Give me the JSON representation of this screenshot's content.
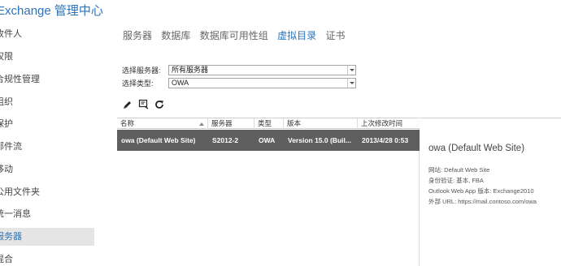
{
  "app": {
    "title": "Exchange 管理中心"
  },
  "sidebar": {
    "items": [
      {
        "label": "收件人",
        "active": false
      },
      {
        "label": "权限",
        "active": false
      },
      {
        "label": "合规性管理",
        "active": false
      },
      {
        "label": "组织",
        "active": false
      },
      {
        "label": "保护",
        "active": false
      },
      {
        "label": "邮件流",
        "active": false
      },
      {
        "label": "移动",
        "active": false
      },
      {
        "label": "公用文件夹",
        "active": false
      },
      {
        "label": "统一消息",
        "active": false
      },
      {
        "label": "服务器",
        "active": true
      },
      {
        "label": "混合",
        "active": false
      }
    ]
  },
  "tabs": [
    {
      "label": "服务器",
      "active": false
    },
    {
      "label": "数据库",
      "active": false
    },
    {
      "label": "数据库可用性组",
      "active": false
    },
    {
      "label": "虚拟目录",
      "active": true
    },
    {
      "label": "证书",
      "active": false
    }
  ],
  "filters": {
    "server_label": "选择服务器:",
    "server_value": "所有服务器",
    "type_label": "选择类型:",
    "type_value": "OWA"
  },
  "toolbar": {
    "icons": [
      "edit-icon",
      "reset-icon",
      "refresh-icon"
    ]
  },
  "grid": {
    "columns": [
      "名称",
      "服务器",
      "类型",
      "版本",
      "上次修改时间"
    ],
    "rows": [
      {
        "name": "owa (Default Web Site)",
        "server": "S2012-2",
        "type": "OWA",
        "version": "Version 15.0 (Buil...",
        "modified": "2013/4/28 0:53"
      }
    ]
  },
  "details": {
    "title": "owa (Default Web Site)",
    "lines": [
      "网站: Default Web Site",
      "身份验证: 基本, FBA",
      "Outlook Web App 版本: Exchange2010",
      "外部 URL: https://mail.contoso.com/owa"
    ]
  },
  "colors": {
    "accent": "#2b73b7",
    "selected_row": "#5f5f5f",
    "sidebar_active": "#e5e5e5"
  }
}
